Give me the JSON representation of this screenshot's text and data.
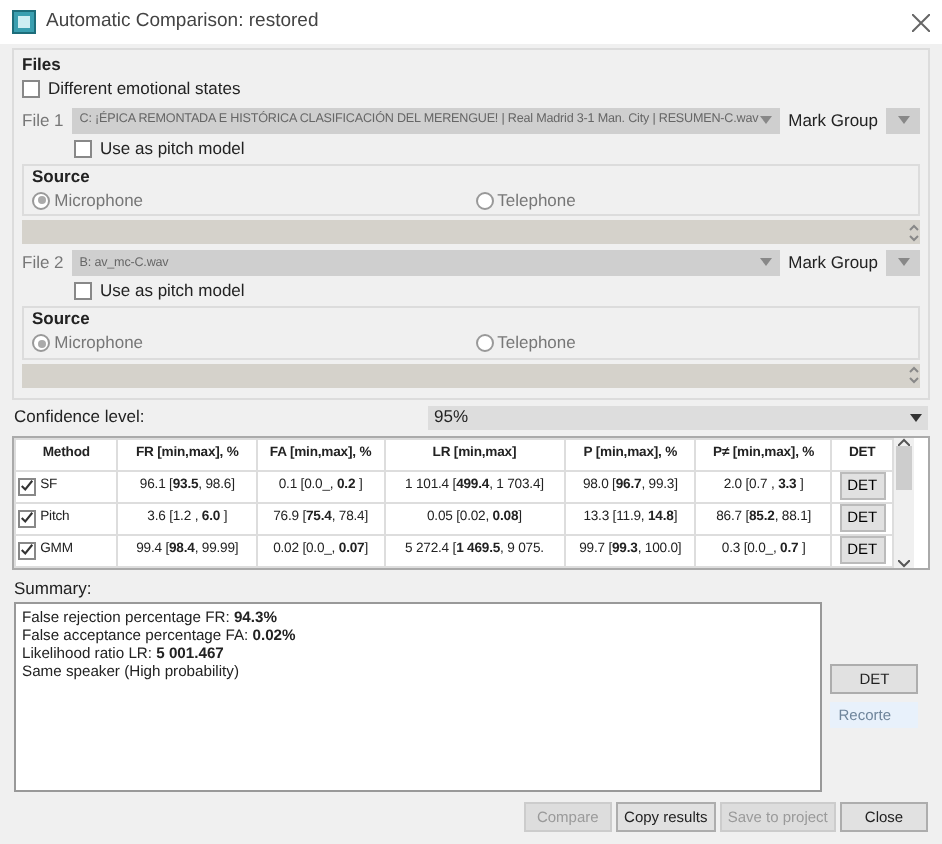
{
  "window": {
    "title": "Automatic Comparison: restored"
  },
  "files_group": {
    "title": "Files",
    "different_emotional_states": {
      "label": "Different emotional states",
      "checked": false
    },
    "files": [
      {
        "label": "File 1",
        "path": "C: ¡ÉPICA REMONTADA E HISTÓRICA CLASIFICACIÓN DEL MERENGUE!  |  Real Madrid 3-1 Man. City  |  RESUMEN-C.wav",
        "mark_group_label": "Mark Group",
        "pitch_model": {
          "label": "Use as pitch model",
          "checked": false
        },
        "source": {
          "title": "Source",
          "options": [
            {
              "label": "Microphone",
              "selected": true
            },
            {
              "label": "Telephone",
              "selected": false
            }
          ]
        }
      },
      {
        "label": "File 2",
        "path": "B: av_mc-C.wav",
        "mark_group_label": "Mark Group",
        "pitch_model": {
          "label": "Use as pitch model",
          "checked": false
        },
        "source": {
          "title": "Source",
          "options": [
            {
              "label": "Microphone",
              "selected": true
            },
            {
              "label": "Telephone",
              "selected": false
            }
          ]
        }
      }
    ]
  },
  "confidence": {
    "label": "Confidence level:",
    "value": "95%"
  },
  "table": {
    "columns": [
      "Method",
      "FR [min,max], %",
      "FA [min,max], %",
      "LR [min,max]",
      "P [min,max], %",
      "P≠ [min,max], %",
      "DET"
    ],
    "rows": [
      {
        "checked": true,
        "cells": [
          "SF",
          "96.1 [**93.5**, 98.6]",
          "0.1 [0.0_, **0.2** ]",
          "1 101.4 [**499.4**, 1 703.4]",
          "98.0 [**96.7**, 99.3]",
          "2.0 [0.7 , **3.3** ]"
        ],
        "button": "DET"
      },
      {
        "checked": true,
        "cells": [
          "Pitch",
          "3.6 [1.2 , **6.0** ]",
          "76.9 [**75.4**, 78.4]",
          "0.05 [0.02, **0.08**]",
          "13.3 [11.9, **14.8**]",
          "86.7 [**85.2**, 88.1]"
        ],
        "button": "DET"
      },
      {
        "checked": true,
        "cells": [
          "GMM",
          "99.4 [**98.4**, 99.99]",
          "0.02 [0.0_, **0.07**]",
          "5 272.4 [**1 469.5**, 9 075.",
          "99.7 [**99.3**, 100.0]",
          "0.3 [0.0_, **0.7** ]"
        ],
        "button": "DET"
      }
    ]
  },
  "summary": {
    "label": "Summary:",
    "lines": [
      "False rejection percentage FR: **94.3%**",
      "False acceptance percentage FA: **0.02%**",
      "Likelihood ratio LR: **5 001.467**",
      "Same speaker (High probability)"
    ]
  },
  "side_button": "DET",
  "tooltip": "Recorte",
  "buttons": [
    {
      "label": "Compare",
      "disabled": true
    },
    {
      "label": "Copy results",
      "disabled": false
    },
    {
      "label": "Save to project",
      "disabled": true
    },
    {
      "label": "Close",
      "disabled": false
    }
  ]
}
